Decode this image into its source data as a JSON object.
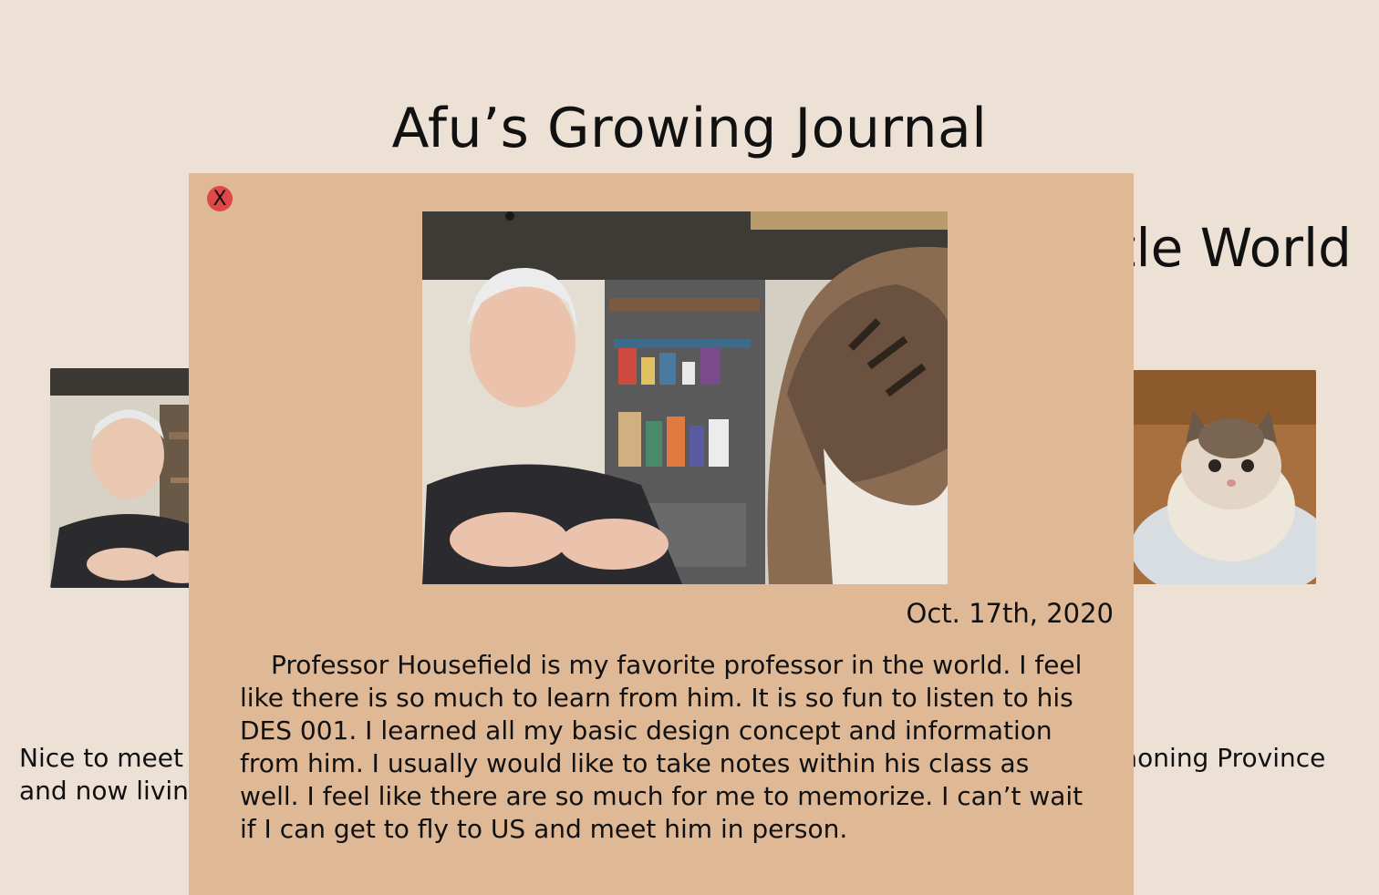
{
  "page": {
    "title": "Afu’s Growing Journal"
  },
  "background": {
    "subtitle_right_fragment": "ttle World",
    "left_caption_lines": [
      "Nice to meet",
      "and now livin"
    ],
    "right_caption_lines": [
      "aoning Province"
    ],
    "left_photo_icon": "professor-photo",
    "right_photo_icon": "cat-photo"
  },
  "modal": {
    "close_label": "X",
    "photo_icon": "professor-with-cat-photo",
    "date": "Oct. 17th, 2020",
    "body": "Professor Housefield is my favorite professor in the world. I feel like there is so much to learn from him. It is so fun to listen to his DES 001. I learned all my basic design concept and information from him. I usually would like to take notes within his class as well. I feel like there are so much for me to memorize. I can’t wait if I can get to fly to US and meet him in person."
  },
  "colors": {
    "page_bg": "#ede1d6",
    "modal_bg": "#dfb895",
    "close_button": "#e04848"
  }
}
